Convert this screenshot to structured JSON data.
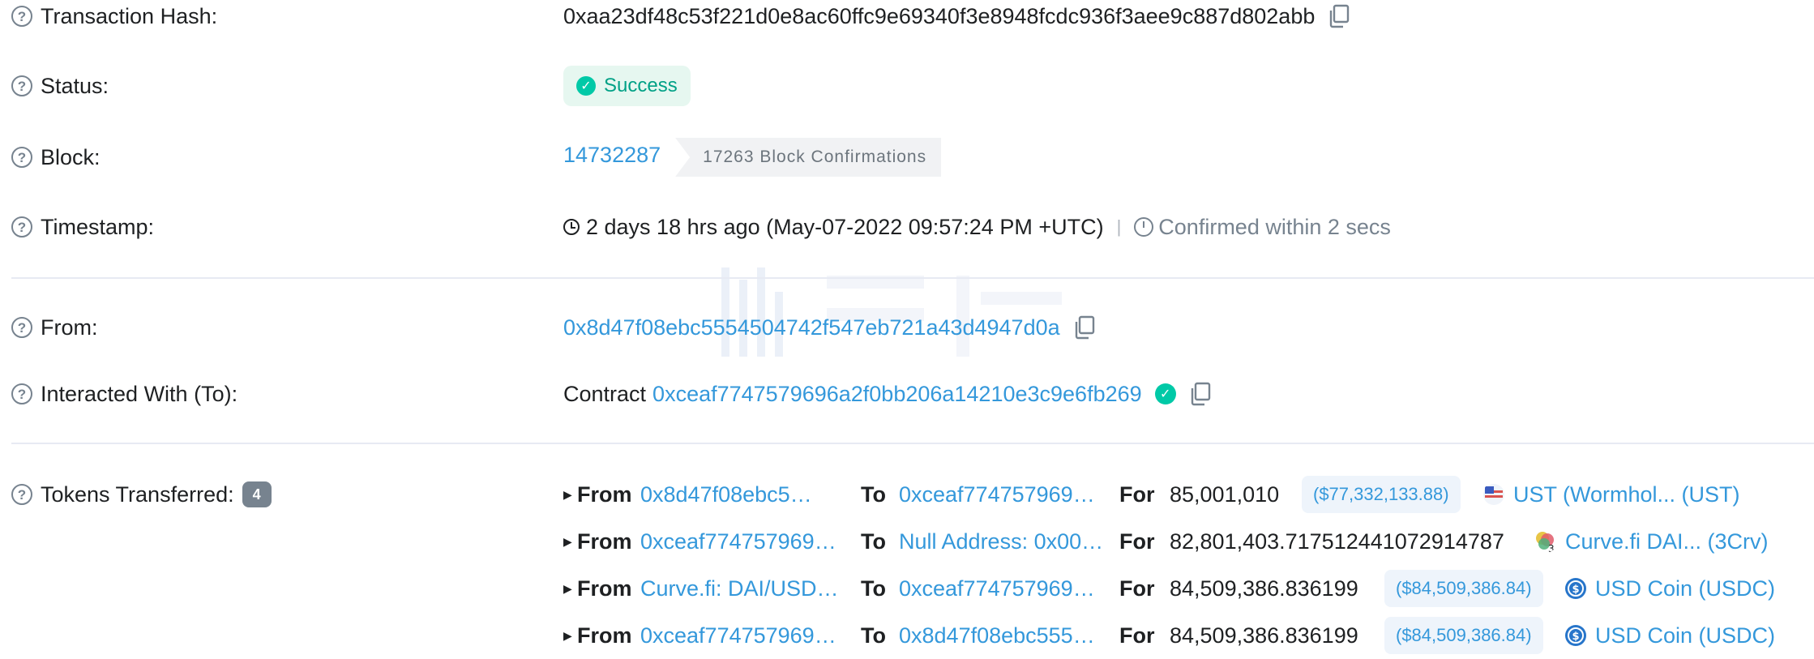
{
  "labels": {
    "tx_hash": "Transaction Hash:",
    "status": "Status:",
    "block": "Block:",
    "timestamp": "Timestamp:",
    "from": "From:",
    "interacted_with": "Interacted With (To):",
    "tokens_transferred": "Tokens Transferred:"
  },
  "help_glyph": "?",
  "tx_hash": "0xaa23df48c53f221d0e8ac60ffc9e69340f3e8948fcdc936f3aee9c887d802abb",
  "status": "Success",
  "block": {
    "number": "14732287",
    "confirmations": "17263 Block Confirmations"
  },
  "timestamp": {
    "text": "2 days 18 hrs ago (May-07-2022 09:57:24 PM +UTC)",
    "separator": "|",
    "confirmed": "Confirmed within 2 secs"
  },
  "from_address": "0x8d47f08ebc5554504742f547eb721a43d4947d0a",
  "interacted_with": {
    "prefix": "Contract",
    "address": "0xceaf7747579696a2f0bb206a14210e3c9e6fb269"
  },
  "tokens_count": "4",
  "transfer_keywords": {
    "from": "From",
    "to": "To",
    "for": "For"
  },
  "transfers": [
    {
      "from": "0x8d47f08ebc555…",
      "to": "0xceaf774757969…",
      "amount": "85,001,010",
      "usd": "($77,332,133.88)",
      "token": "UST (Wormhol... (UST)"
    },
    {
      "from": "0xceaf774757969…",
      "to": "Null Address: 0x00…",
      "amount": "82,801,403.717512441072914787",
      "usd": "",
      "token": "Curve.fi DAI... (3Crv)"
    },
    {
      "from": "Curve.fi: DAI/USD…",
      "to": "0xceaf774757969…",
      "amount": "84,509,386.836199",
      "usd": "($84,509,386.84)",
      "token": "USD Coin (USDC)"
    },
    {
      "from": "0xceaf774757969…",
      "to": "0x8d47f08ebc555…",
      "amount": "84,509,386.836199",
      "usd": "($84,509,386.84)",
      "token": "USD Coin (USDC)"
    }
  ],
  "colors": {
    "link": "#3498db",
    "success": "#00c9a7",
    "muted": "#77838f"
  }
}
